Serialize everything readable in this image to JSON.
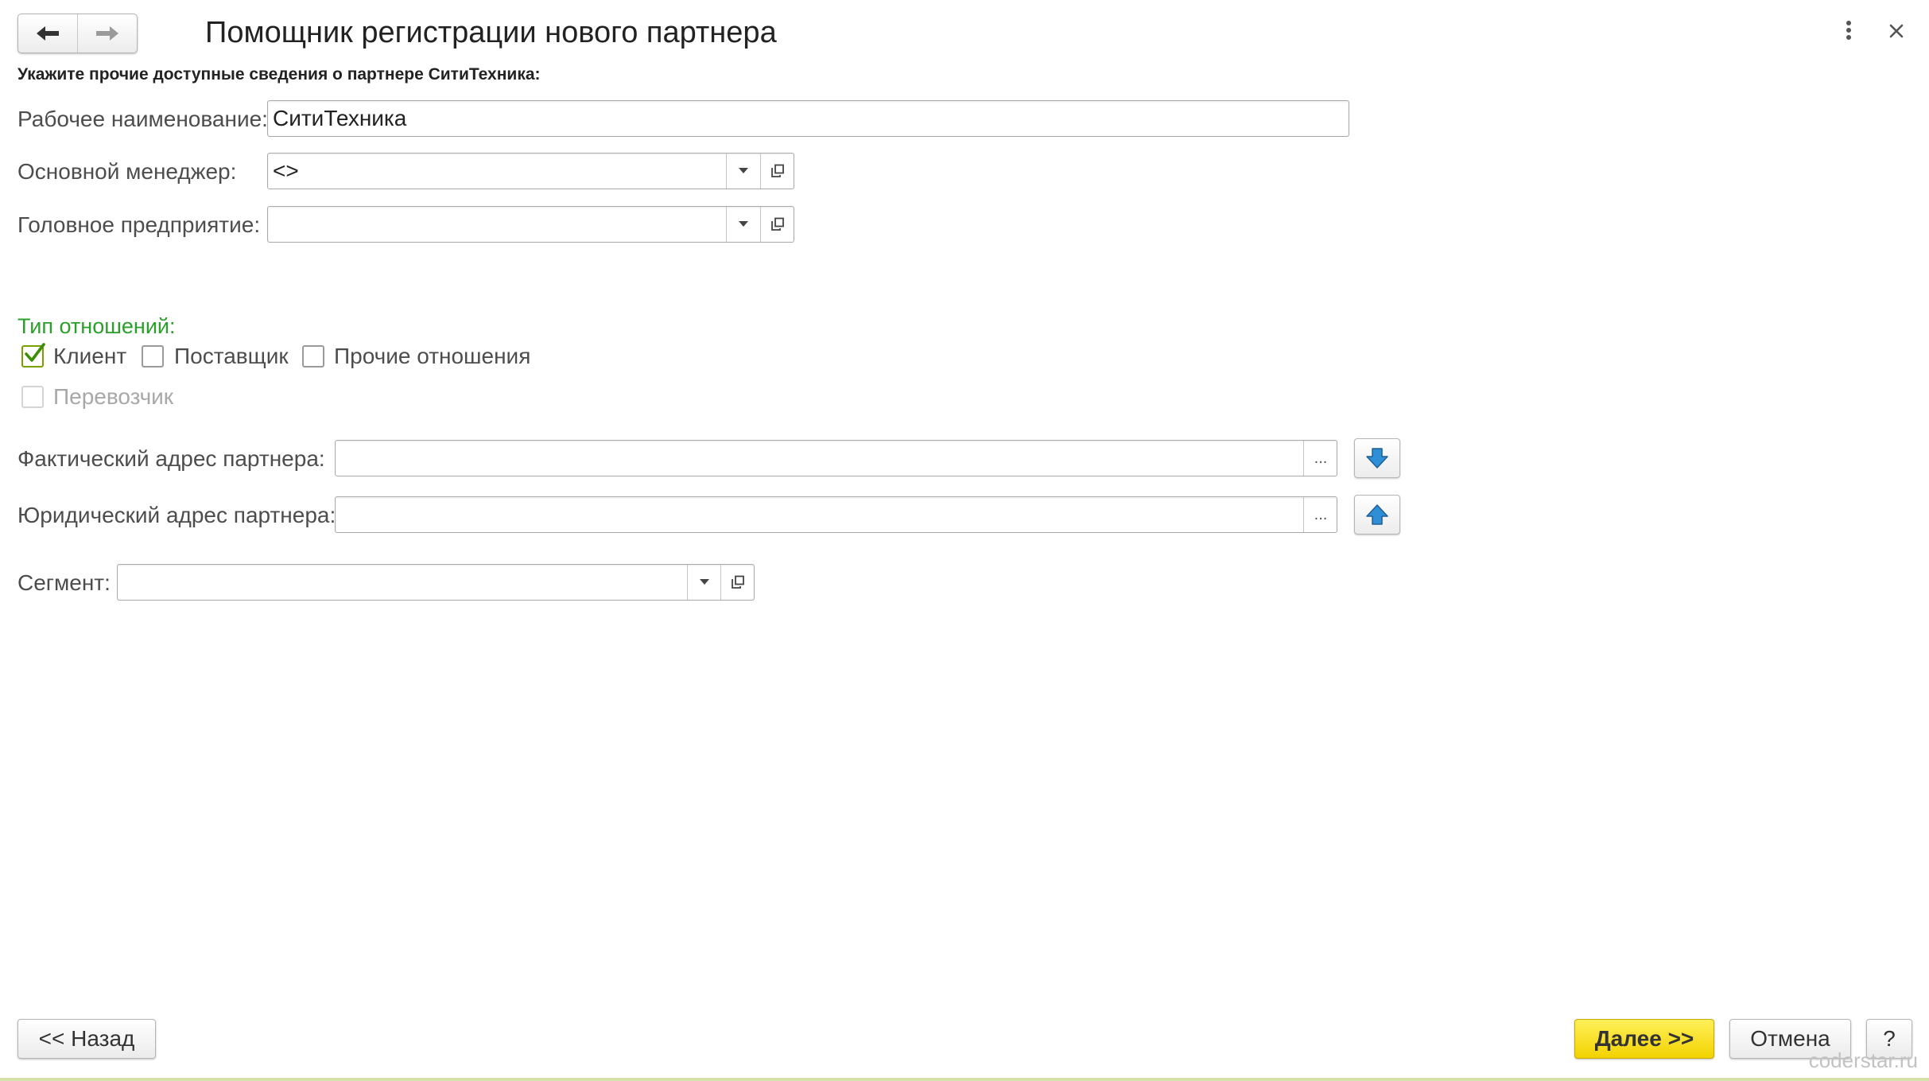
{
  "header": {
    "title": "Помощник регистрации нового партнера",
    "back_icon": "arrow-left-icon",
    "forward_icon": "arrow-right-icon",
    "more_icon": "more-vertical-icon",
    "close_icon": "close-icon"
  },
  "subtitle": "Укажите прочие доступные сведения о партнере СитиТехника:",
  "fields": {
    "work_name": {
      "label": "Рабочее наименование:",
      "value": "СитиТехника"
    },
    "manager": {
      "label": "Основной менеджер:",
      "value": "<>"
    },
    "head_company": {
      "label": "Головное предприятие:",
      "value": ""
    },
    "actual_address": {
      "label": "Фактический адрес партнера:",
      "value": "",
      "select_button": "..."
    },
    "legal_address": {
      "label": "Юридический адрес партнера:",
      "value": "",
      "select_button": "..."
    },
    "segment": {
      "label": "Сегмент:",
      "value": ""
    }
  },
  "relations": {
    "title": "Тип отношений:",
    "client": {
      "label": "Клиент",
      "checked": true
    },
    "supplier": {
      "label": "Поставщик",
      "checked": false
    },
    "other": {
      "label": "Прочие отношения",
      "checked": false
    },
    "carrier": {
      "label": "Перевозчик",
      "checked": false,
      "disabled": true
    }
  },
  "footer": {
    "back": "<< Назад",
    "next": "Далее >>",
    "cancel": "Отмена",
    "help": "?"
  },
  "watermark": "coderstar.ru",
  "colors": {
    "accent_green": "#2aa02a",
    "primary_button": "#f2d200",
    "arrow_blue": "#2f8fd6"
  }
}
